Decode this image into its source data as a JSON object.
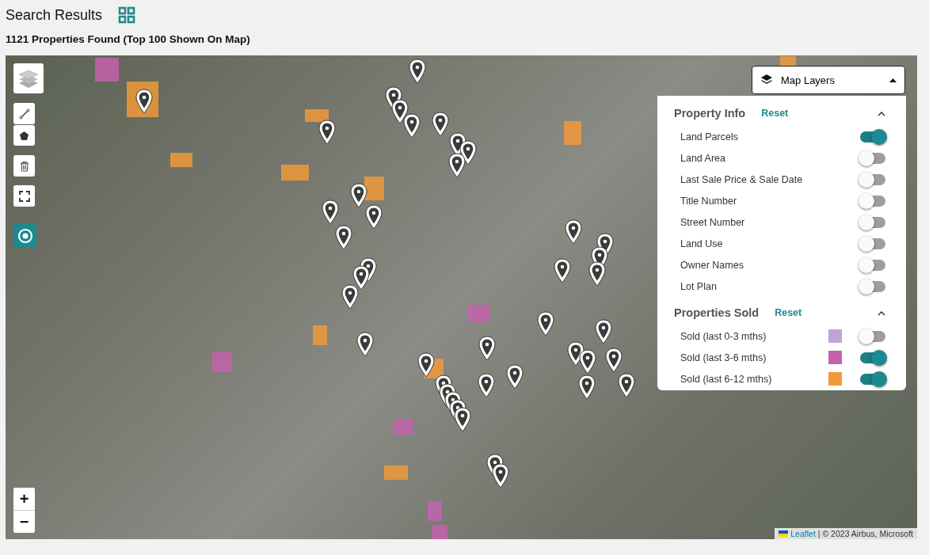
{
  "header": {
    "title": "Search Results",
    "subtitle": "1121 Properties Found (Top 100 Shown On Map)"
  },
  "map": {
    "layers_button": "Map Layers",
    "zoom_in": "+",
    "zoom_out": "−",
    "attribution": {
      "link": "Leaflet",
      "text": "| © 2023 Airbus, Microsoft"
    }
  },
  "property_info": {
    "title": "Property Info",
    "reset": "Reset",
    "expanded": true,
    "items": [
      {
        "label": "Land Parcels",
        "on": true
      },
      {
        "label": "Land Area",
        "on": false
      },
      {
        "label": "Last Sale Price & Sale Date",
        "on": false
      },
      {
        "label": "Title Number",
        "on": false
      },
      {
        "label": "Street Number",
        "on": false
      },
      {
        "label": "Land Use",
        "on": false
      },
      {
        "label": "Owner Names",
        "on": false
      },
      {
        "label": "Lot Plan",
        "on": false
      }
    ]
  },
  "properties_sold": {
    "title": "Properties Sold",
    "reset": "Reset",
    "expanded": true,
    "items": [
      {
        "label": "Sold (last 0-3 mths)",
        "color": "#c0a4d6",
        "on": false
      },
      {
        "label": "Sold (last 3-6 mths)",
        "color": "#c462ad",
        "on": true
      },
      {
        "label": "Sold (last 6-12 mths)",
        "color": "#f0993a",
        "on": true
      }
    ]
  }
}
